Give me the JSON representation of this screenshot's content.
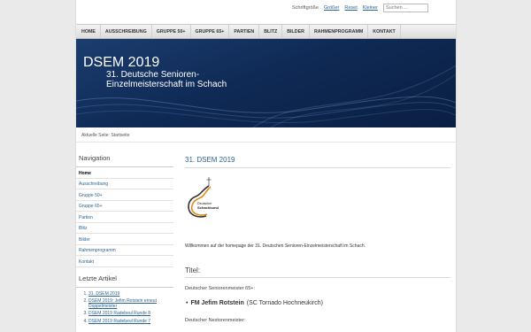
{
  "util": {
    "font_label": "Schriftgröße",
    "bigger": "Größer",
    "reset": "Reset",
    "smaller": "Kleiner",
    "search_placeholder": "Suchen ..."
  },
  "nav": [
    "HOME",
    "AUSSCHREIBUNG",
    "GRUPPE 50+",
    "GRUPPE 65+",
    "PARTIEN",
    "BLITZ",
    "BILDER",
    "RAHMENPROGRAMM",
    "KONTAKT"
  ],
  "banner": {
    "title": "DSEM 2019",
    "subtitle": "31. Deutsche Senioren-Einzelmeisterschaft im Schach"
  },
  "breadcrumb": "Aktuelle Seite: Startseite",
  "sidebar": {
    "nav_heading": "Navigation",
    "items": [
      "Home",
      "Ausschreibung",
      "Gruppe 50+",
      "Gruppe 65+",
      "Partien",
      "Blitz",
      "Bilder",
      "Rahmenprogramm",
      "Kontakt"
    ],
    "latest_heading": "Letzte Artikel",
    "latest": [
      "31. DSEM 2019",
      "DSEM 2019: Jefim Rotstein erneut Doppelmeister",
      "DSEM 2019 Radebeul Runde 8",
      "DSEM 2019 Radebeul Runde 7"
    ]
  },
  "main": {
    "title": "31. DSEM 2019",
    "logo_text1": "Deutscher",
    "logo_text2": "Schachbund",
    "welcome": "Willkommen auf der homepage der 31. Deutschen Senioren-Einzelmeisterschaft im Schach.",
    "section_title": "Titel:",
    "label_senior": "Deutscher Seniorenmeister 65+:",
    "champion_title": "FM Jefim Rotstein",
    "champion_club": "(SC Tornado Hochneukirch)",
    "label_nestor": "Deutscher Nestorenmeister:"
  },
  "colors": {
    "link": "#2a6496",
    "banner": "#0f2a55",
    "logo_orange": "#e08a1e"
  }
}
